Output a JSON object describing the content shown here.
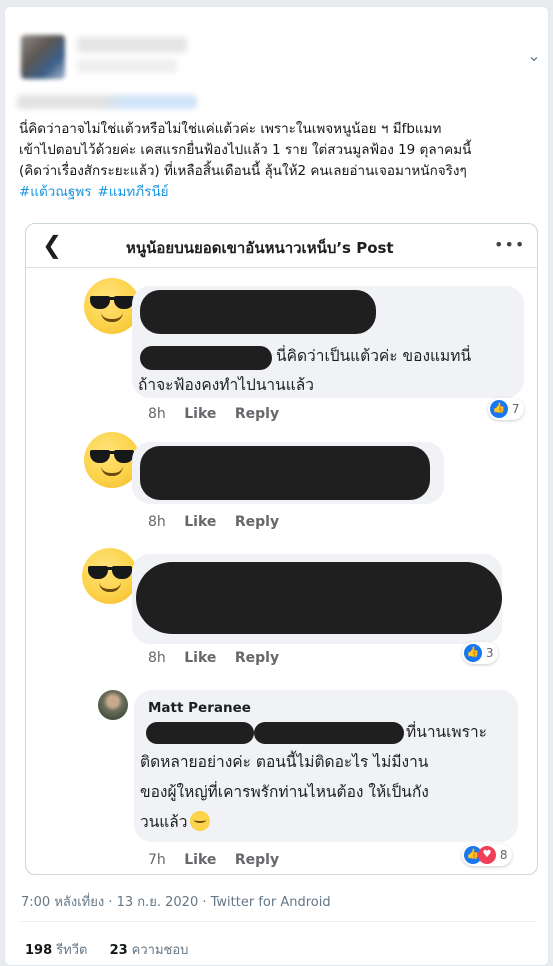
{
  "tweet": {
    "text_lines": [
      "นี่คิดว่าอาจไม่ใช่แต้วหรือไม่ใช่แค่แต้วค่ะ เพราะในเพจหนูน้อย ฯ มีfbแมท",
      "เข้าไปตอบไว้ด้วยค่ะ เคสแรกยื่นฟ้องไปแล้ว 1 ราย ใต่สวนมูลฟ้อง 19 ตุลาคมนี้",
      "(คิดว่าเรื่องสักระยะแล้ว) ที่เหลือสิ้นเดือนนี้ ลุ้นให้2 คนเลยอ่านเจอมาหนักจริงๆ"
    ],
    "hashtags": [
      "#แต้วณฐพร",
      "#แมทภีรนีย์"
    ],
    "timestamp": "7:00 หลังเที่ยง · 13 ก.ย. 2020 · Twitter for Android",
    "stats": {
      "retweets_count": "198",
      "retweets_label": "รีทวีต",
      "likes_count": "23",
      "likes_label": "ความชอบ"
    }
  },
  "fb_post": {
    "title": "หนูน้อยบนยอดเขาอันหนาวเหน็บ’s Post",
    "comments": [
      {
        "text_line1": "นี่คิดว่าเป็นแต้วค่ะ ของแมทนี่",
        "text_line2": "ถ้าจะฟ้องคงทำไปนานแล้ว",
        "time": "8h",
        "like": "Like",
        "reply": "Reply",
        "reaction_count": "7"
      },
      {
        "time": "8h",
        "like": "Like",
        "reply": "Reply"
      },
      {
        "time": "8h",
        "like": "Like",
        "reply": "Reply",
        "reaction_count": "3"
      },
      {
        "author": "Matt Peranee",
        "text_line1": "ที่นานเพราะ",
        "text_line2": "ติดหลายอย่างค่ะ ตอนนี้ไม่ติดอะไร ไม่มีงาน",
        "text_line3": "ของผู้ใหญ่ที่เคารพรักท่านไหนต้อง ให้เป็นกัง",
        "text_line4": "วนแล้ว",
        "time": "7h",
        "like": "Like",
        "reply": "Reply",
        "reaction_count": "8"
      }
    ]
  },
  "colors": {
    "hashtag": "#1b95e0",
    "fb_like": "#1877f2",
    "fb_love": "#f33e58",
    "bubble": "#f0f2f5",
    "redaction": "#1f1f1f"
  },
  "icons": {
    "back": "back-arrow-icon",
    "more": "more-dots-icon",
    "caret": "chevron-down-icon"
  }
}
